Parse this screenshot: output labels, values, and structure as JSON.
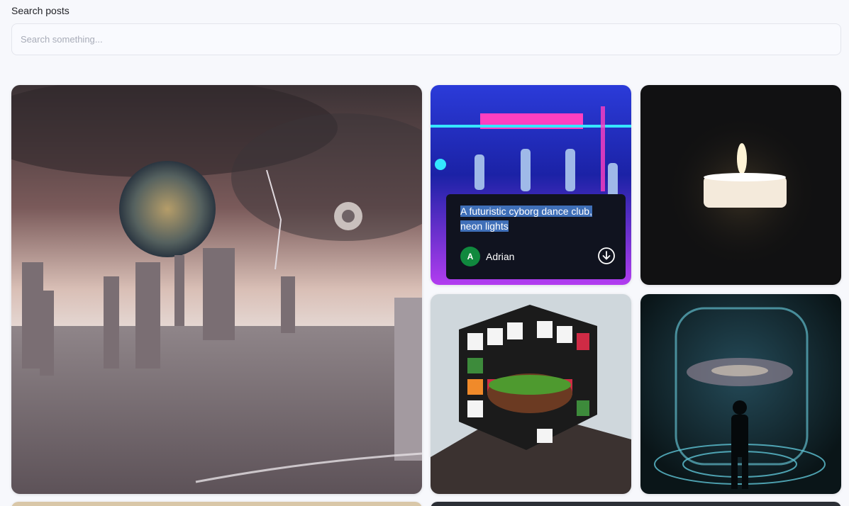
{
  "search": {
    "label": "Search posts",
    "placeholder": "Search something..."
  },
  "posts": [
    {
      "id": "post-1",
      "hover": false
    },
    {
      "id": "post-2",
      "hover": true,
      "prompt": "A futuristic cyborg dance club, neon lights",
      "author": "Adrian",
      "avatar_letter": "A",
      "avatar_color": "#10893e",
      "download_icon": "download-icon"
    },
    {
      "id": "post-3",
      "hover": false
    },
    {
      "id": "post-4",
      "hover": false
    },
    {
      "id": "post-5",
      "hover": false
    }
  ]
}
